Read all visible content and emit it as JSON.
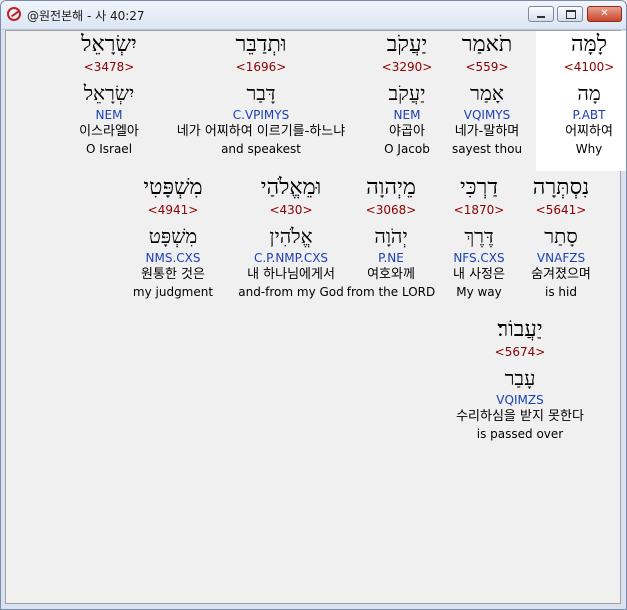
{
  "window": {
    "title": "@원전본해 - 사 40:27",
    "icons": {
      "app": "app-logo-icon",
      "minimize": "minimize-icon",
      "maximize": "maximize-icon",
      "close": "close-icon"
    },
    "close_label": "✕"
  },
  "words": [
    {
      "hebrew": "לָמָּה",
      "strong": "<4100>",
      "root": "מָה",
      "parse": "P.ABT",
      "korean": "어찌하여",
      "english": "Why",
      "selected": true
    },
    {
      "hebrew": "תֹאמַר",
      "strong": "<559>",
      "root": "אָמַר",
      "parse": "VQIMYS",
      "korean": "네가-말하며",
      "english": "sayest thou"
    },
    {
      "hebrew": "יַעֲקֹב",
      "strong": "<3290>",
      "root": "יַעֲקֹב",
      "parse": "NEM",
      "korean": "야곱아",
      "english": "O Jacob"
    },
    {
      "hebrew": "וּתְדַבֵּר",
      "strong": "<1696>",
      "root": "דָּבַר",
      "parse": "C.VPIMYS",
      "korean": "네가 어찌하여 이르기를-하느냐",
      "english": "and speakest"
    },
    {
      "hebrew": "יִשְׂרָאֵל",
      "strong": "<3478>",
      "root": "יִשְׂרָאֵל",
      "parse": "NEM",
      "korean": "이스라엘아",
      "english": "O Israel"
    },
    {
      "hebrew": "נִסְתְּרָה",
      "strong": "<5641>",
      "root": "סָתַר",
      "parse": "VNAFZS",
      "korean": "숨겨졌으며",
      "english": "is hid"
    },
    {
      "hebrew": "דַרְכִּי",
      "strong": "<1870>",
      "root": "דֶּרֶךְ",
      "parse": "NFS.CXS",
      "korean": "내 사정은",
      "english": "My way"
    },
    {
      "hebrew": "מֵיְהוָה",
      "strong": "<3068>",
      "root": "יְהֹוָה",
      "parse": "P.NE",
      "korean": "여호와께",
      "english": "from the LORD"
    },
    {
      "hebrew": "וּמֵאֱלֹהַי",
      "strong": "<430>",
      "root": "אֱלֹהִין",
      "parse": "C.P.NMP.CXS",
      "korean": "내 하나님에게서",
      "english": "and-from my God"
    },
    {
      "hebrew": "מִשְׁפָּטִי",
      "strong": "<4941>",
      "root": "מִשְׁפָּט",
      "parse": "NMS.CXS",
      "korean": "원통한 것은",
      "english": "my judgment"
    },
    {
      "hebrew": "יַעֲבוֹר׃",
      "strong": "<5674>",
      "root": "עָבַר",
      "parse": "VQIMZS",
      "korean": "수리하심을 받지 못한다",
      "english": "is passed over"
    }
  ]
}
